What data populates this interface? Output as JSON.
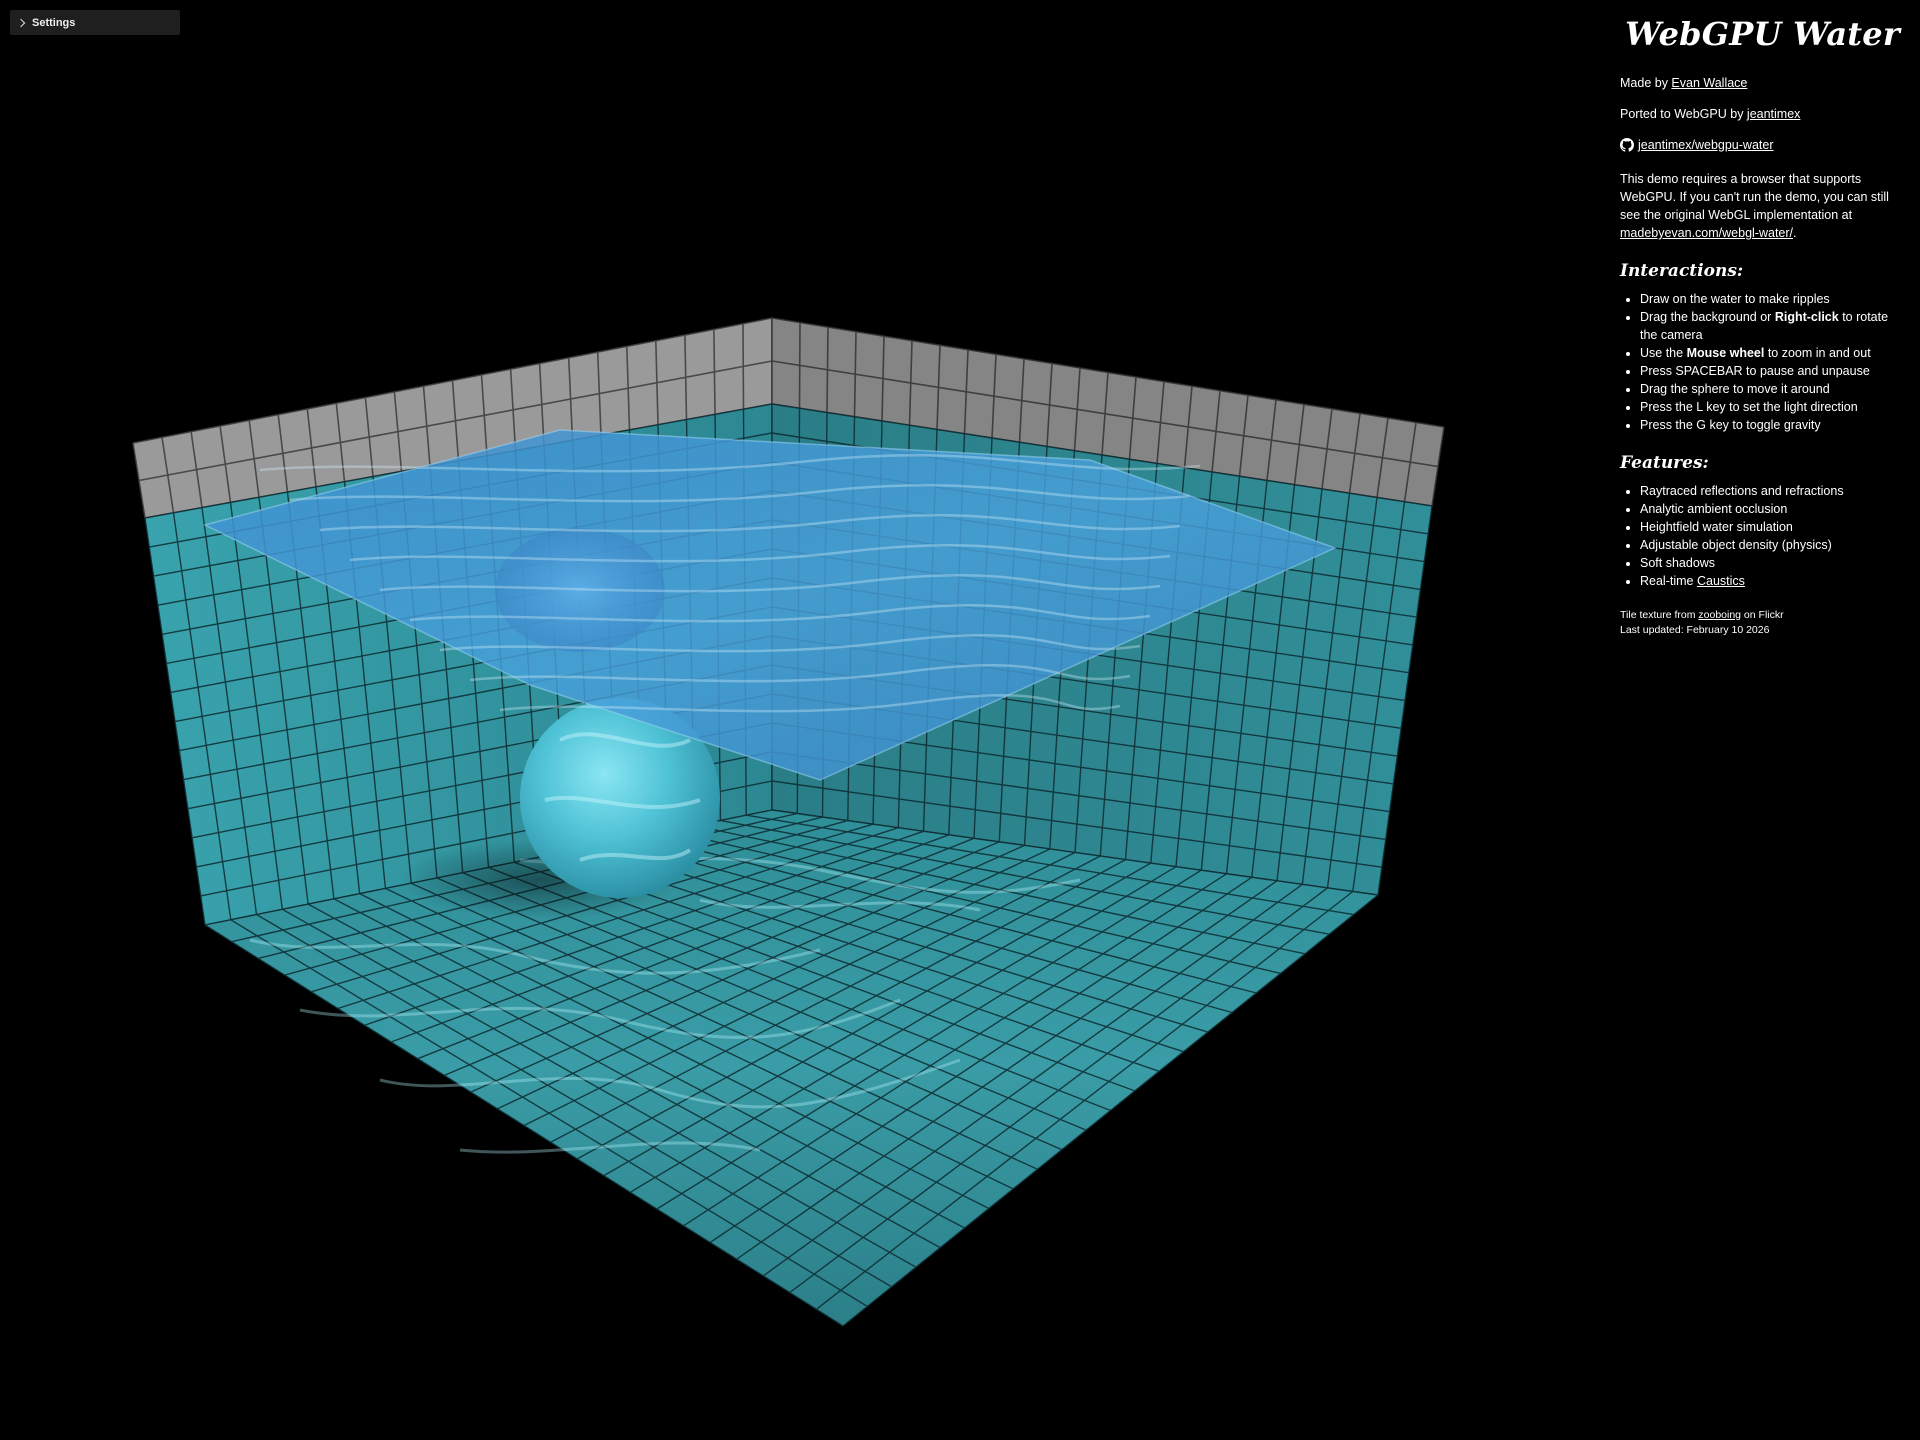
{
  "settings": {
    "label": "Settings",
    "icon": "chevron-right-icon"
  },
  "info": {
    "title": "WebGPU Water",
    "made_by_prefix": "Made by ",
    "made_by_link": "Evan Wallace",
    "ported_prefix": "Ported to WebGPU by ",
    "ported_link": "jeantimex",
    "repo_icon": "github-icon",
    "repo_link": "jeantimex/webgpu-water",
    "requirement_text": "This demo requires a browser that supports WebGPU. If you can't run the demo, you can still see the original WebGL implementation at ",
    "requirement_link": "madebyevan.com/webgl-water/",
    "requirement_suffix": ".",
    "interactions_heading": "Interactions:",
    "interactions": [
      {
        "pre": "Draw on the water to make ripples",
        "bold": "",
        "post": ""
      },
      {
        "pre": "Drag the background or ",
        "bold": "Right-click",
        "post": " to rotate the camera"
      },
      {
        "pre": "Use the ",
        "bold": "Mouse wheel",
        "post": " to zoom in and out"
      },
      {
        "pre": "Press SPACEBAR to pause and unpause",
        "bold": "",
        "post": ""
      },
      {
        "pre": "Drag the sphere to move it around",
        "bold": "",
        "post": ""
      },
      {
        "pre": "Press the L key to set the light direction",
        "bold": "",
        "post": ""
      },
      {
        "pre": "Press the G key to toggle gravity",
        "bold": "",
        "post": ""
      }
    ],
    "features_heading": "Features:",
    "features": [
      {
        "text": "Raytraced reflections and refractions",
        "link": ""
      },
      {
        "text": "Analytic ambient occlusion",
        "link": ""
      },
      {
        "text": "Heightfield water simulation",
        "link": ""
      },
      {
        "text": "Adjustable object density (physics)",
        "link": ""
      },
      {
        "text": "Soft shadows",
        "link": ""
      },
      {
        "text": "Real-time ",
        "link": "Caustics"
      }
    ],
    "tile_prefix": "Tile texture from ",
    "tile_link": "zooboing",
    "tile_suffix": " on Flickr",
    "last_updated": "Last updated: February 10 2026"
  },
  "scene": {
    "water_color": "#3aa8c4",
    "tile_color": "#4fb3c0",
    "grout_color": "#0d2a30",
    "rim_tile_color": "#9a9a9a",
    "sphere_color": "#5ccbe0"
  }
}
